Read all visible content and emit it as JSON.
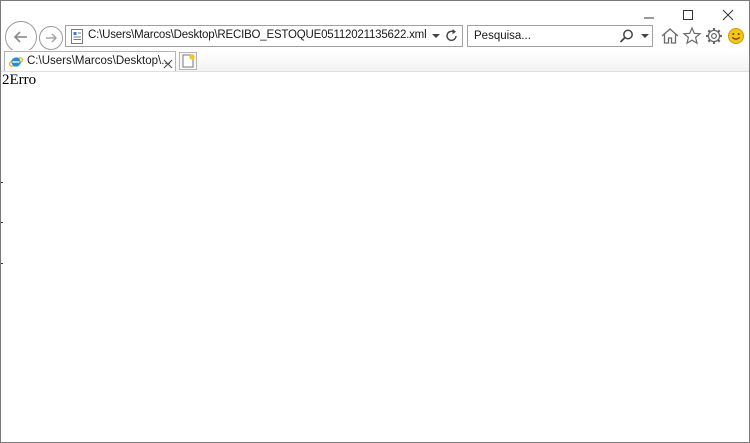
{
  "window": {
    "controls": {
      "minimize": "minimize",
      "maximize": "maximize",
      "close": "close"
    }
  },
  "nav": {
    "address": "C:\\Users\\Marcos\\Desktop\\RECIBO_ESTOQUE05112021135622.xml",
    "search_placeholder": "Pesquisa..."
  },
  "tab": {
    "title": "C:\\Users\\Marcos\\Desktop\\..."
  },
  "content": {
    "text": "2Erro"
  },
  "icons": {
    "back": "back-arrow-icon",
    "forward": "forward-arrow-icon",
    "page": "xml-page-icon",
    "refresh": "refresh-icon",
    "search": "magnifier-icon",
    "home": "home-icon",
    "favorites": "star-icon",
    "tools": "gear-icon",
    "feedback": "smiley-icon",
    "tab": "ie-logo-icon",
    "new_tab": "new-tab-icon"
  },
  "colors": {
    "border": "#7a7a7a",
    "ie_blue": "#1e90d8",
    "smiley": "#f5c518"
  }
}
